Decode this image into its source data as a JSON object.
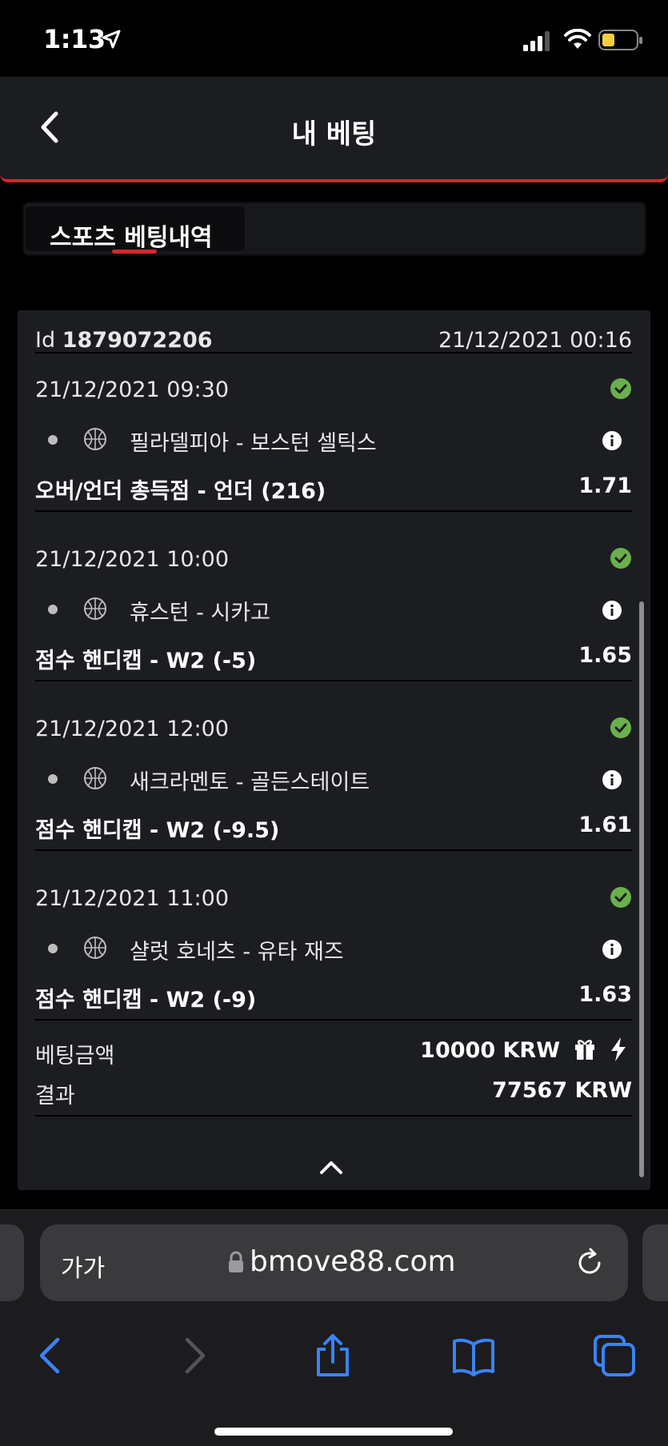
{
  "status_bar": {
    "time": "1:13"
  },
  "header": {
    "title": "내 베팅"
  },
  "tabs": [
    {
      "label": "스포츠 베팅내역",
      "active": true
    }
  ],
  "bet": {
    "id_label": "Id",
    "id_value": "1879072206",
    "placed_at": "21/12/2021 00:16",
    "selections": [
      {
        "date": "21/12/2021 09:30",
        "match": "필라델피아 - 보스턴 셀틱스",
        "market": "오버/언더 총득점 - 언더 (216)",
        "odds": "1.71",
        "status": "won"
      },
      {
        "date": "21/12/2021 10:00",
        "match": "휴스턴 - 시카고",
        "market": "점수 핸디캡 - W2 (-5)",
        "odds": "1.65",
        "status": "won"
      },
      {
        "date": "21/12/2021 12:00",
        "match": "새크라멘토 - 골든스테이트",
        "market": "점수 핸디캡 - W2 (-9.5)",
        "odds": "1.61",
        "status": "won"
      },
      {
        "date": "21/12/2021 11:00",
        "match": "샬럿 호네츠 - 유타 재즈",
        "market": "점수 핸디캡 - W2 (-9)",
        "odds": "1.63",
        "status": "won"
      }
    ],
    "stake_label": "베팅금액",
    "stake_value": "10000 KRW",
    "result_label": "결과",
    "result_value": "77567 KRW"
  },
  "browser": {
    "text_size_label": "가가",
    "url": "bmove88.com"
  },
  "colors": {
    "accent": "#d6262b",
    "success": "#6ab04c",
    "link": "#3b82f6",
    "card": "#1c1d21"
  }
}
